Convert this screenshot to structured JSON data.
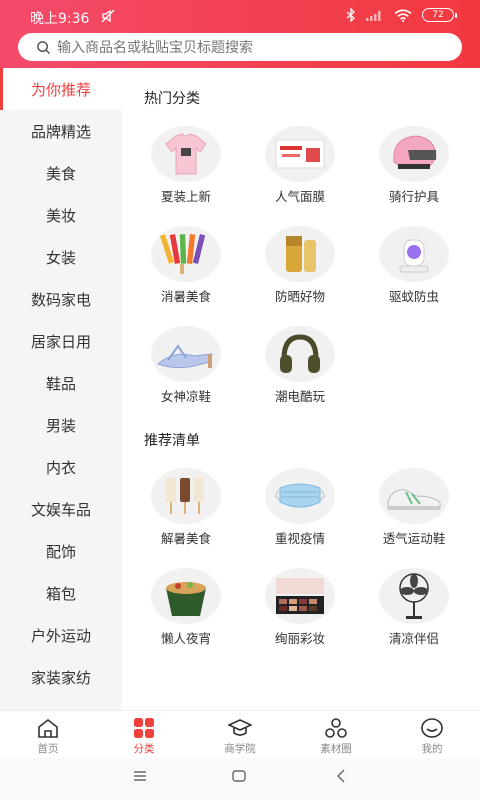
{
  "status_bar": {
    "time": "晚上9:36",
    "battery": "72"
  },
  "search": {
    "placeholder": "输入商品名或粘贴宝贝标题搜索"
  },
  "sidebar": {
    "items": [
      {
        "label": "为你推荐",
        "active": true
      },
      {
        "label": "品牌精选"
      },
      {
        "label": "美食"
      },
      {
        "label": "美妆"
      },
      {
        "label": "女装"
      },
      {
        "label": "数码家电"
      },
      {
        "label": "居家日用"
      },
      {
        "label": "鞋品"
      },
      {
        "label": "男装"
      },
      {
        "label": "内衣"
      },
      {
        "label": "文娱车品"
      },
      {
        "label": "配饰"
      },
      {
        "label": "箱包"
      },
      {
        "label": "户外运动"
      },
      {
        "label": "家装家纺"
      }
    ]
  },
  "hot": {
    "title": "热门分类",
    "items": [
      {
        "label": "夏装上新",
        "icon": "tshirt-icon"
      },
      {
        "label": "人气面膜",
        "icon": "face-mask-box-icon"
      },
      {
        "label": "骑行护具",
        "icon": "helmet-icon"
      },
      {
        "label": "消暑美食",
        "icon": "popsicle-icon"
      },
      {
        "label": "防晒好物",
        "icon": "sunscreen-icon"
      },
      {
        "label": "驱蚊防虫",
        "icon": "mosquito-lamp-icon"
      },
      {
        "label": "女神凉鞋",
        "icon": "sandal-icon"
      },
      {
        "label": "潮电酷玩",
        "icon": "headphones-icon"
      }
    ]
  },
  "rec": {
    "title": "推荐清单",
    "items": [
      {
        "label": "解暑美食",
        "icon": "ice-cream-bar-icon"
      },
      {
        "label": "重视疫情",
        "icon": "medical-mask-icon"
      },
      {
        "label": "透气运动鞋",
        "icon": "sneaker-icon"
      },
      {
        "label": "懒人夜宵",
        "icon": "instant-noodle-icon"
      },
      {
        "label": "绚丽彩妆",
        "icon": "eyeshadow-palette-icon"
      },
      {
        "label": "清凉伴侣",
        "icon": "fan-icon"
      }
    ]
  },
  "tabbar": {
    "items": [
      {
        "label": "首页",
        "icon": "home-icon"
      },
      {
        "label": "分类",
        "icon": "category-icon",
        "active": true
      },
      {
        "label": "商学院",
        "icon": "graduation-cap-icon"
      },
      {
        "label": "素材圈",
        "icon": "material-circle-icon"
      },
      {
        "label": "我的",
        "icon": "profile-icon"
      }
    ]
  },
  "colors": {
    "accent": "#f0413f",
    "header_start": "#f54a6c",
    "header_end": "#f3383f"
  }
}
